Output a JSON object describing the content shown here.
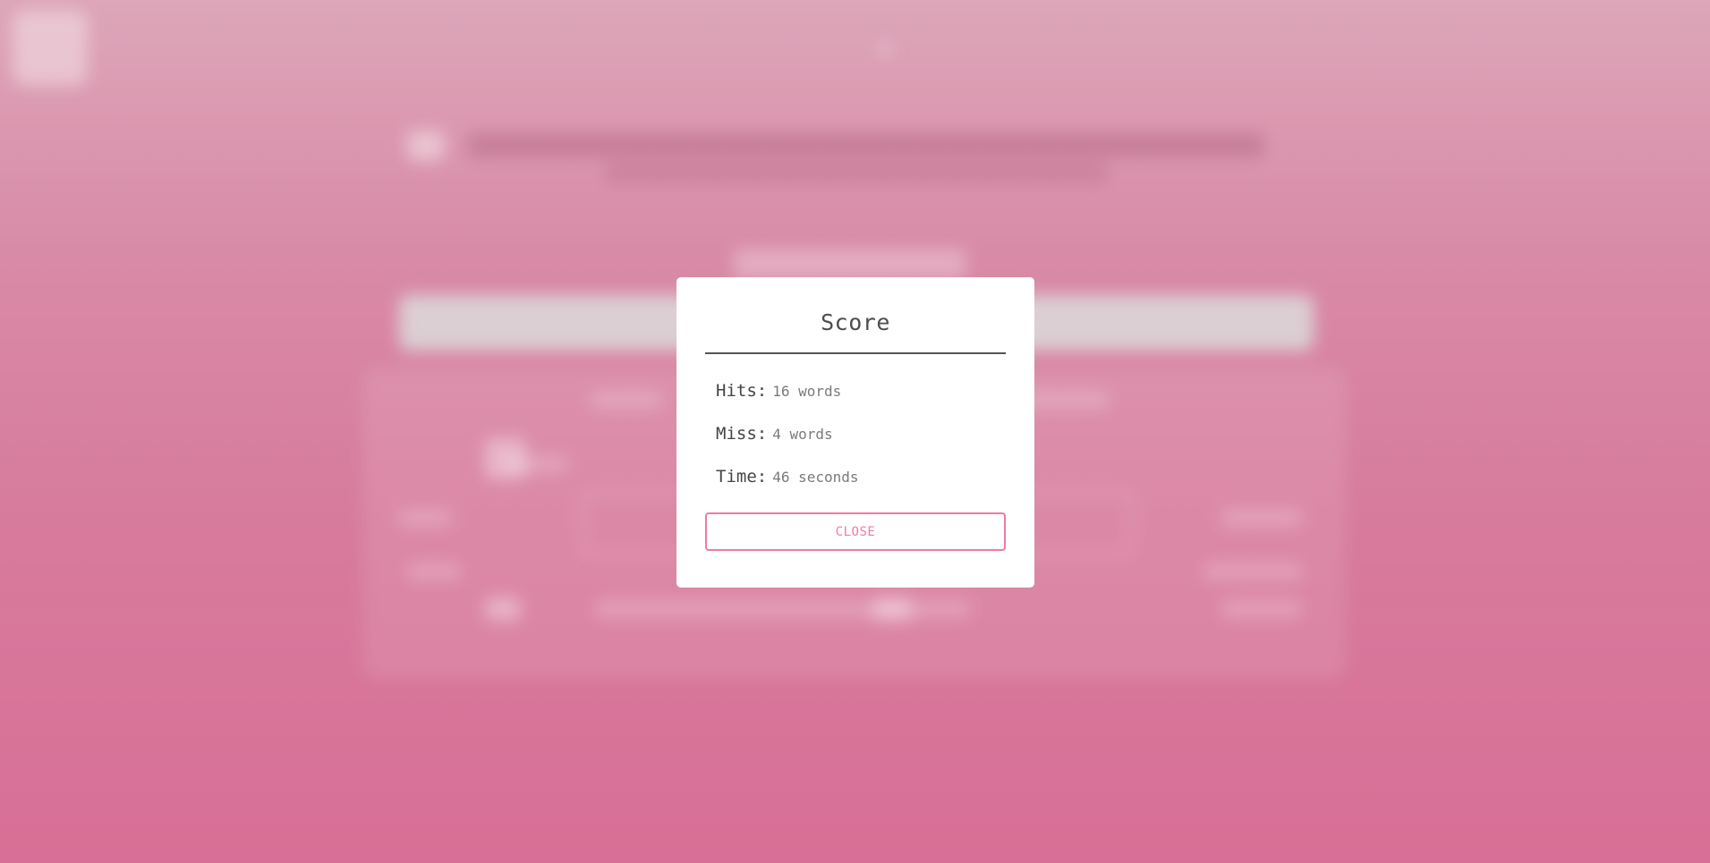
{
  "modal": {
    "title": "Score",
    "stats": [
      {
        "label": "Hits:",
        "value": "16 words"
      },
      {
        "label": "Miss:",
        "value": "4 words"
      },
      {
        "label": "Time:",
        "value": "46 seconds"
      }
    ],
    "close_label": "CLOSE"
  },
  "colors": {
    "accent": "#f07aa3",
    "background_top": "#dda6b9",
    "background_bottom": "#d86f96",
    "modal_bg": "#ffffff"
  }
}
